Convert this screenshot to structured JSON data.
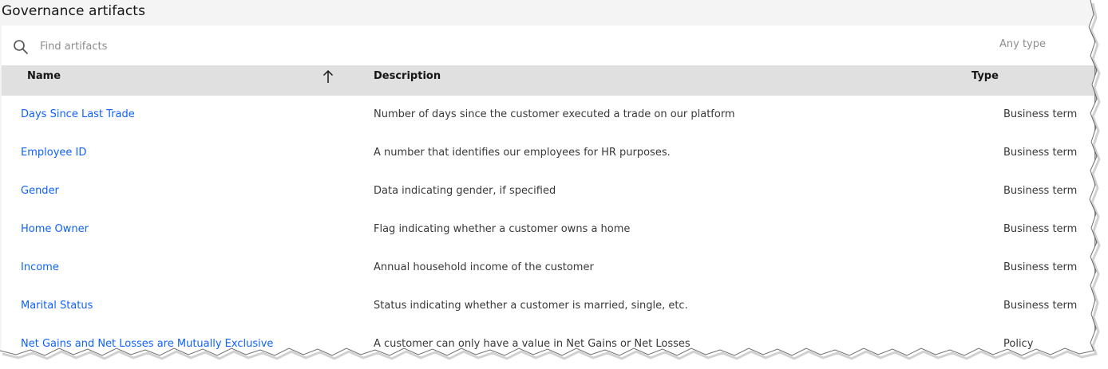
{
  "page": {
    "title": "Governance artifacts"
  },
  "toolbar": {
    "search_placeholder": "Find artifacts",
    "type_filter_label": "Any type"
  },
  "table": {
    "columns": {
      "name": "Name",
      "description": "Description",
      "type": "Type"
    },
    "sort": {
      "column": "Name",
      "direction": "ascending"
    },
    "rows": [
      {
        "name": "Days Since Last Trade",
        "description": "Number of days since the customer executed a trade on our platform",
        "type": "Business term"
      },
      {
        "name": "Employee ID",
        "description": "A number that identifies our employees for HR purposes.",
        "type": "Business term"
      },
      {
        "name": "Gender",
        "description": "Data indicating gender, if specified",
        "type": "Business term"
      },
      {
        "name": "Home Owner",
        "description": "Flag indicating whether a customer owns a home",
        "type": "Business term"
      },
      {
        "name": "Income",
        "description": "Annual household income of the customer",
        "type": "Business term"
      },
      {
        "name": "Marital Status",
        "description": "Status indicating whether a customer is married, single, etc.",
        "type": "Business term"
      },
      {
        "name": "Net Gains and Net Losses are Mutually Exclusive",
        "description": "A customer can only have a value in Net Gains or Net Losses",
        "type": "Policy"
      }
    ]
  },
  "icons": {
    "search": "search-icon",
    "sort": "arrow-up-icon"
  },
  "colors": {
    "link": "#0f62fe",
    "header_bg": "#e0e0e0",
    "page_bg": "#f4f4f4"
  }
}
